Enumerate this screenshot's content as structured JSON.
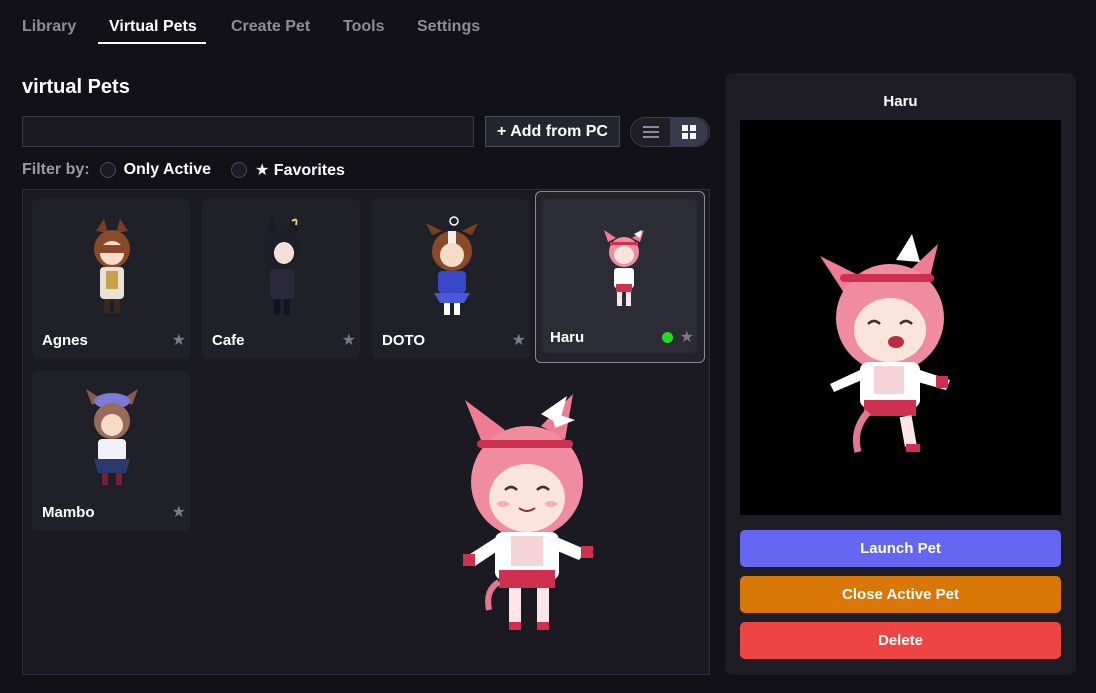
{
  "tabs": [
    {
      "label": "Library"
    },
    {
      "label": "Virtual Pets"
    },
    {
      "label": "Create Pet"
    },
    {
      "label": "Tools"
    },
    {
      "label": "Settings"
    }
  ],
  "active_tab": "Virtual Pets",
  "page": {
    "title": "virtual Pets"
  },
  "search": {
    "value": "",
    "placeholder": ""
  },
  "toolbar": {
    "add_label": "+ Add from PC"
  },
  "filter": {
    "label": "Filter by:",
    "only_active": "Only Active",
    "favorites": "★ Favorites"
  },
  "pets": [
    {
      "name": "Agnes",
      "star": "★",
      "active": false,
      "hair": "#8a4a2a",
      "outfit": "#e8e2d4"
    },
    {
      "name": "Cafe",
      "star": "★",
      "active": false,
      "hair": "#1e1e2a",
      "outfit": "#2a2a3a"
    },
    {
      "name": "DOTO",
      "star": "★",
      "active": false,
      "hair": "#8a4a2a",
      "outfit": "#3848c8"
    },
    {
      "name": "Haru",
      "star": "★",
      "active": true,
      "hair": "#f08ca0",
      "outfit": "#ffffff"
    },
    {
      "name": "Mambo",
      "star": "★",
      "active": false,
      "hair": "#9a6a5a",
      "outfit": "#2a3a6a"
    }
  ],
  "selected": {
    "name": "Haru"
  },
  "actions": {
    "launch": "Launch Pet",
    "close": "Close Active Pet",
    "delete": "Delete"
  },
  "colors": {
    "launch": "#6366f1",
    "close": "#d97706",
    "delete": "#ef4444",
    "active_dot": "#22dd22"
  },
  "icons": {
    "list_view": "list-icon",
    "grid_view": "grid-icon",
    "star": "star-icon"
  }
}
